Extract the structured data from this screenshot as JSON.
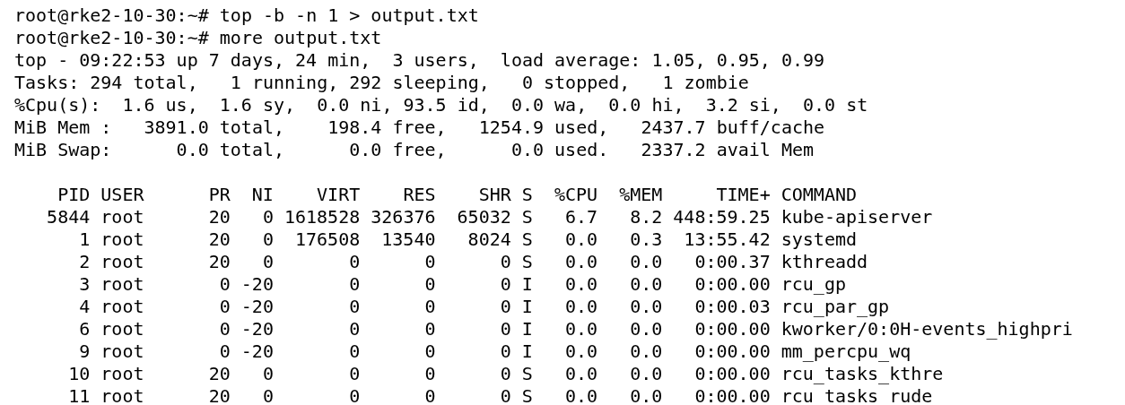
{
  "commands": [
    {
      "prompt": "root@rke2-10-30:~#",
      "command": "top -b -n 1 > output.txt"
    },
    {
      "prompt": "root@rke2-10-30:~#",
      "command": "more output.txt"
    }
  ],
  "summary_lines": [
    "top - 09:22:53 up 7 days, 24 min,  3 users,  load average: 1.05, 0.95, 0.99",
    "Tasks: 294 total,   1 running, 292 sleeping,   0 stopped,   1 zombie",
    "%Cpu(s):  1.6 us,  1.6 sy,  0.0 ni, 93.5 id,  0.0 wa,  0.0 hi,  3.2 si,  0.0 st",
    "MiB Mem :   3891.0 total,    198.4 free,   1254.9 used,   2437.7 buff/cache",
    "MiB Swap:      0.0 total,      0.0 free,      0.0 used.   2337.2 avail Mem"
  ],
  "process_table": {
    "columns": [
      "PID",
      "USER",
      "PR",
      "NI",
      "VIRT",
      "RES",
      "SHR",
      "S",
      "%CPU",
      "%MEM",
      "TIME+",
      "COMMAND"
    ],
    "rows": [
      [
        "5844",
        "root",
        "20",
        "0",
        "1618528",
        "326376",
        "65032",
        "S",
        "6.7",
        "8.2",
        "448:59.25",
        "kube-apiserver"
      ],
      [
        "1",
        "root",
        "20",
        "0",
        "176508",
        "13540",
        "8024",
        "S",
        "0.0",
        "0.3",
        "13:55.42",
        "systemd"
      ],
      [
        "2",
        "root",
        "20",
        "0",
        "0",
        "0",
        "0",
        "S",
        "0.0",
        "0.0",
        "0:00.37",
        "kthreadd"
      ],
      [
        "3",
        "root",
        "0",
        "-20",
        "0",
        "0",
        "0",
        "I",
        "0.0",
        "0.0",
        "0:00.00",
        "rcu_gp"
      ],
      [
        "4",
        "root",
        "0",
        "-20",
        "0",
        "0",
        "0",
        "I",
        "0.0",
        "0.0",
        "0:00.03",
        "rcu_par_gp"
      ],
      [
        "6",
        "root",
        "0",
        "-20",
        "0",
        "0",
        "0",
        "I",
        "0.0",
        "0.0",
        "0:00.00",
        "kworker/0:0H-events_highpri"
      ],
      [
        "9",
        "root",
        "0",
        "-20",
        "0",
        "0",
        "0",
        "I",
        "0.0",
        "0.0",
        "0:00.00",
        "mm_percpu_wq"
      ],
      [
        "10",
        "root",
        "20",
        "0",
        "0",
        "0",
        "0",
        "S",
        "0.0",
        "0.0",
        "0:00.00",
        "rcu_tasks_kthre"
      ],
      [
        "11",
        "root",
        "20",
        "0",
        "0",
        "0",
        "0",
        "S",
        "0.0",
        "0.0",
        "0:00.00",
        "rcu_tasks_rude"
      ]
    ]
  }
}
